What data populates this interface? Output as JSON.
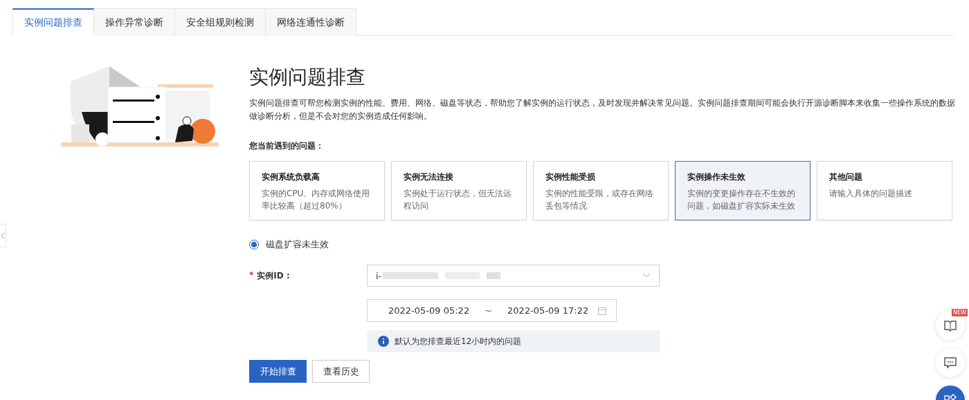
{
  "tabs": [
    {
      "label": "实例问题排查",
      "selected": true
    },
    {
      "label": "操作异常诊断",
      "selected": false
    },
    {
      "label": "安全组规则检测",
      "selected": false
    },
    {
      "label": "网络连通性诊断",
      "selected": false
    }
  ],
  "title": "实例问题排查",
  "description": "实例问题排查可帮您检测实例的性能、费用、网络、磁盘等状态，帮助您了解实例的运行状态，及时发现并解决常见问题。实例问题排查期间可能会执行开源诊断脚本来收集一些操作系统的数据做诊断分析，但是不会对您的实例造成任何影响。",
  "problems_label": "您当前遇到的问题：",
  "problems": [
    {
      "title": "实例系统负载高",
      "desc": "实例的CPU、内存或网络使用率比较高（超过80%）",
      "selected": false
    },
    {
      "title": "实例无法连接",
      "desc": "实例处于运行状态，但无法远程访问",
      "selected": false
    },
    {
      "title": "实例性能受损",
      "desc": "实例的性能受限，或存在网络丢包等情况",
      "selected": false
    },
    {
      "title": "实例操作未生效",
      "desc": "实例的变更操作存在不生效的问题，如磁盘扩容实际未生效",
      "selected": true
    },
    {
      "title": "其他问题",
      "desc": "请输入具体的问题描述",
      "selected": false
    }
  ],
  "options": [
    {
      "label": "磁盘扩容未生效",
      "selected": true
    }
  ],
  "instance_field": {
    "required_mark": "*",
    "label": "实例ID :",
    "value": "i-"
  },
  "time_range": {
    "start": "2022-05-09 05:22",
    "separator": "~",
    "end": "2022-05-09 17:22"
  },
  "notice": "默认为您排查最近12小时内的问题",
  "buttons": [
    {
      "label": "开始排查",
      "kind": "primary"
    },
    {
      "label": "查看历史",
      "kind": "default"
    }
  ],
  "float_badge": "NEW"
}
